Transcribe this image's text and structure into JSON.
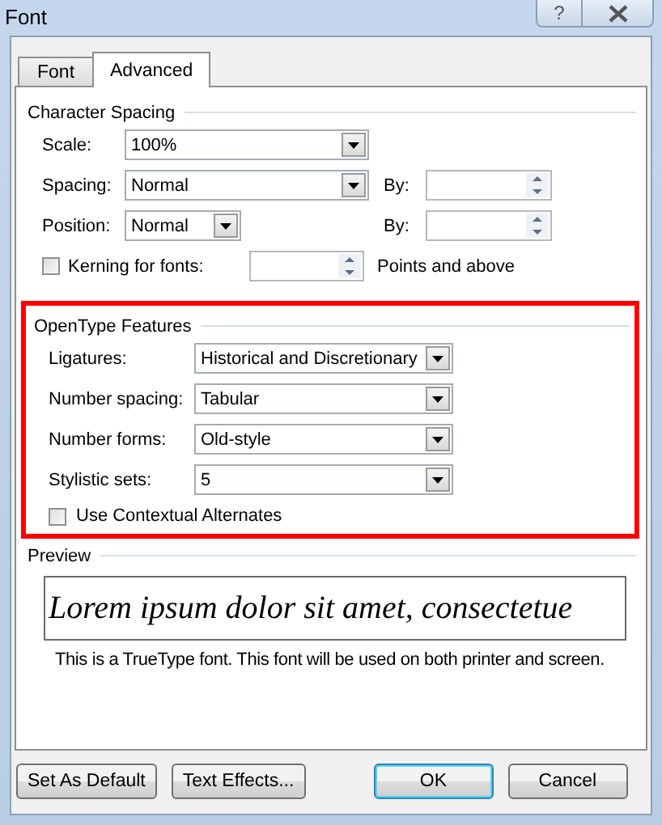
{
  "window": {
    "title": "Font",
    "help": "?"
  },
  "tabs": [
    {
      "label": "Font",
      "selected": false
    },
    {
      "label": "Advanced",
      "selected": true
    }
  ],
  "character_spacing": {
    "title": "Character Spacing",
    "scale": {
      "label": "Scale:",
      "value": "100%"
    },
    "spacing": {
      "label": "Spacing:",
      "value": "Normal",
      "by_label": "By:"
    },
    "position": {
      "label": "Position:",
      "value": "Normal",
      "by_label": "By:"
    },
    "kerning": {
      "label": "Kerning for fonts:",
      "checked": false,
      "suffix": "Points and above"
    }
  },
  "opentype": {
    "title": "OpenType Features",
    "rows": [
      {
        "label": "Ligatures:",
        "value": "Historical and Discretionary"
      },
      {
        "label": "Number spacing:",
        "value": "Tabular"
      },
      {
        "label": "Number forms:",
        "value": "Old-style"
      },
      {
        "label": "Stylistic sets:",
        "value": "5"
      }
    ],
    "contextual": {
      "label": "Use Contextual Alternates",
      "checked": false
    }
  },
  "preview": {
    "title": "Preview",
    "sample": "Lorem ipsum dolor sit amet, consectetue",
    "note": "This is a TrueType font. This font will be used on both printer and screen."
  },
  "buttons": [
    {
      "label": "Set As Default",
      "kind": "normal"
    },
    {
      "label": "Text Effects...",
      "kind": "normal"
    },
    {
      "label": "OK",
      "kind": "default"
    },
    {
      "label": "Cancel",
      "kind": "normal"
    }
  ]
}
